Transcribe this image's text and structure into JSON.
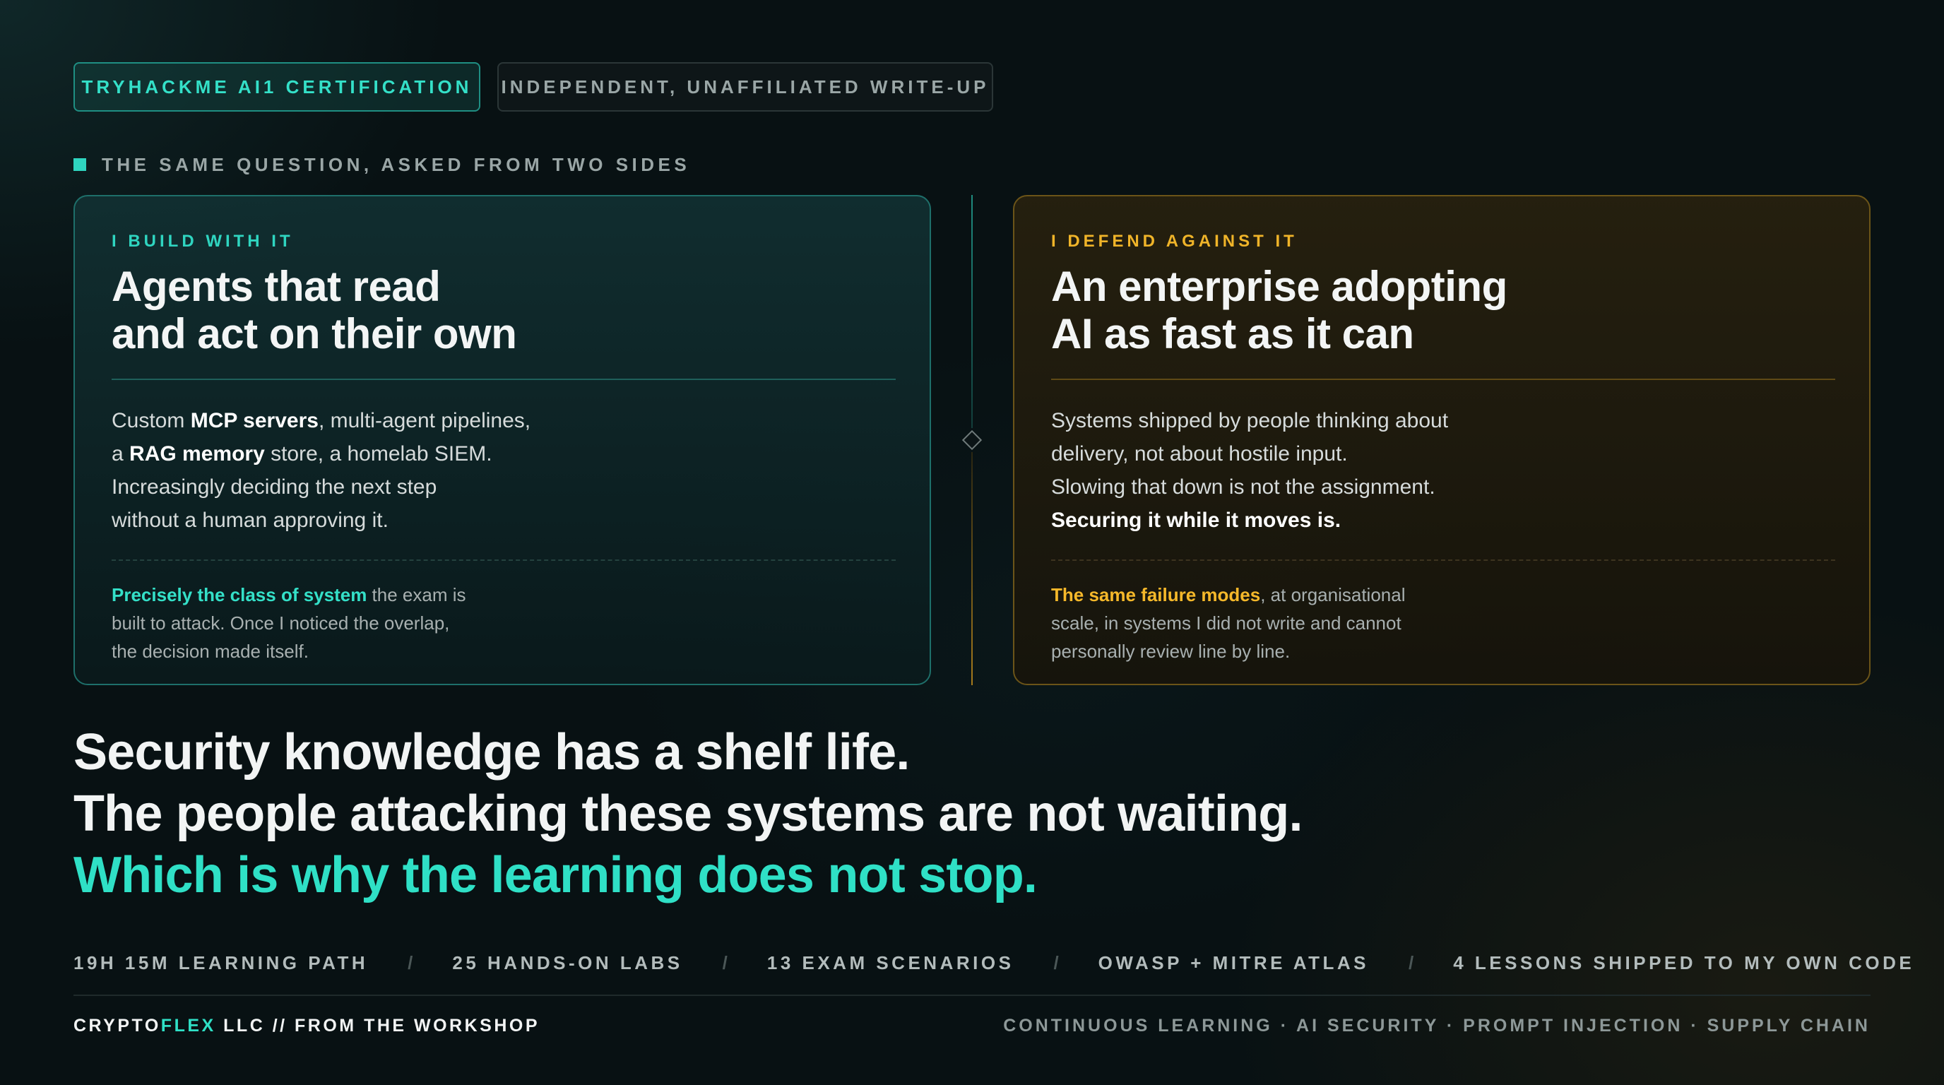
{
  "badges": {
    "primary": "TRYHACKME AI1 CERTIFICATION",
    "secondary": "INDEPENDENT, UNAFFILIATED WRITE-UP"
  },
  "section_label": "THE SAME QUESTION, ASKED FROM TWO SIDES",
  "left_card": {
    "eyebrow": "I BUILD WITH IT",
    "title_lines": [
      "Agents that read",
      "and act on their own"
    ],
    "body": {
      "l1_a": "Custom ",
      "l1_b": "MCP servers",
      "l1_c": ", multi-agent pipelines,",
      "l2_a": "a ",
      "l2_b": "RAG memory",
      "l2_c": " store, a homelab SIEM.",
      "l3": "Increasingly deciding the next step",
      "l4": "without a human approving it."
    },
    "foot": {
      "highlight": "Precisely the class of system",
      "l1_rest": " the exam is",
      "l2": "built to attack. Once I noticed the overlap,",
      "l3": "the decision made itself."
    }
  },
  "right_card": {
    "eyebrow": "I DEFEND AGAINST IT",
    "title_lines": [
      "An enterprise adopting",
      "AI as fast as it can"
    ],
    "body": {
      "l1": "Systems shipped by people thinking about",
      "l2": "delivery, not about hostile input.",
      "l3": "Slowing that down is not the assignment.",
      "l4": "Securing it while it moves is."
    },
    "foot": {
      "highlight": "The same failure modes",
      "l1_rest": ", at organisational",
      "l2": "scale, in systems I did not write and cannot",
      "l3": "personally review line by line."
    }
  },
  "headline": {
    "line1": "Security knowledge has a shelf life.",
    "line2": "The people attacking these systems are not waiting.",
    "line3": "Which is why the learning does not stop."
  },
  "stats": [
    "19H 15M LEARNING PATH",
    "25 HANDS-ON LABS",
    "13 EXAM SCENARIOS",
    "OWASP + MITRE ATLAS",
    "4 LESSONS SHIPPED TO MY OWN CODE"
  ],
  "stats_separator": "/",
  "footer": {
    "brand_a": "CRYPTO",
    "brand_b": "FLEX",
    "brand_c": " LLC // FROM THE WORKSHOP",
    "tags": "CONTINUOUS LEARNING · AI SECURITY · PROMPT INJECTION · SUPPLY CHAIN"
  },
  "colors": {
    "accent_teal": "#2fe0c6",
    "accent_amber": "#f0b429",
    "background": "#081113"
  }
}
